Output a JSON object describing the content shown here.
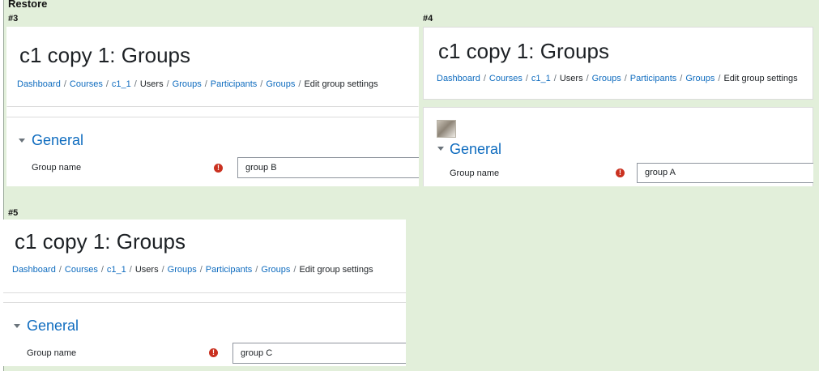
{
  "sheet": {
    "title": "Restore"
  },
  "panels": [
    {
      "label": "#3",
      "page_title": "c1 copy 1: Groups",
      "breadcrumb": [
        "Dashboard",
        "Courses",
        "c1_1",
        "Users",
        "Groups",
        "Participants",
        "Groups",
        "Edit group settings"
      ],
      "section": "General",
      "field_label": "Group name",
      "required_mark": "!",
      "group_name_value": "group B"
    },
    {
      "label": "#4",
      "page_title": "c1 copy 1: Groups",
      "breadcrumb": [
        "Dashboard",
        "Courses",
        "c1_1",
        "Users",
        "Groups",
        "Participants",
        "Groups",
        "Edit group settings"
      ],
      "section": "General",
      "field_label": "Group name",
      "required_mark": "!",
      "group_name_value": "group A"
    },
    {
      "label": "#5",
      "page_title": "c1 copy 1: Groups",
      "breadcrumb": [
        "Dashboard",
        "Courses",
        "c1_1",
        "Users",
        "Groups",
        "Participants",
        "Groups",
        "Edit group settings"
      ],
      "section": "General",
      "field_label": "Group name",
      "required_mark": "!",
      "group_name_value": "group C"
    }
  ],
  "breadcrumb_separator": "/",
  "colors": {
    "sheet_background": "#e2efda",
    "link": "#0f6cbf",
    "required": "#ca3120"
  },
  "icons": {
    "section_toggle": "chevron-down-icon",
    "required": "exclamation-circle-icon"
  }
}
